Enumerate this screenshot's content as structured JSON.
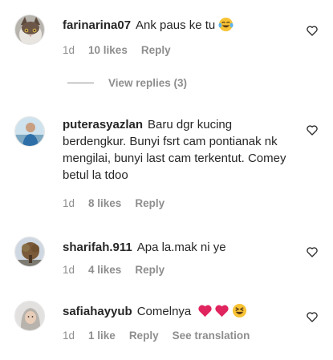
{
  "comments": [
    {
      "username": "farinarina07",
      "text": "Ank paus ke tu",
      "emoji": "laughing-tears-emoji",
      "time": "1d",
      "likes": "10 likes",
      "reply": "Reply",
      "view_replies": "View replies (3)"
    },
    {
      "username": "puterasyazlan",
      "text": "Baru dgr kucing berdengkur. Bunyi fsrt cam pontianak nk mengilai, bunyi last cam terkentut. Comey betul la tdoo",
      "time": "1d",
      "likes": "8 likes",
      "reply": "Reply"
    },
    {
      "username": "sharifah.911",
      "text": "Apa la.mak ni ye",
      "time": "1d",
      "likes": "4 likes",
      "reply": "Reply"
    },
    {
      "username": "safiahayyub",
      "text": "Comelnya",
      "emoji": "hearts-and-laughing-emoji",
      "time": "1d",
      "likes": "1 like",
      "reply": "Reply",
      "see_translation": "See translation"
    }
  ],
  "colors": {
    "text": "#262626",
    "meta": "#8e8e8e",
    "heart_red": "#e0245e",
    "emoji_yellow": "#f7c234"
  }
}
